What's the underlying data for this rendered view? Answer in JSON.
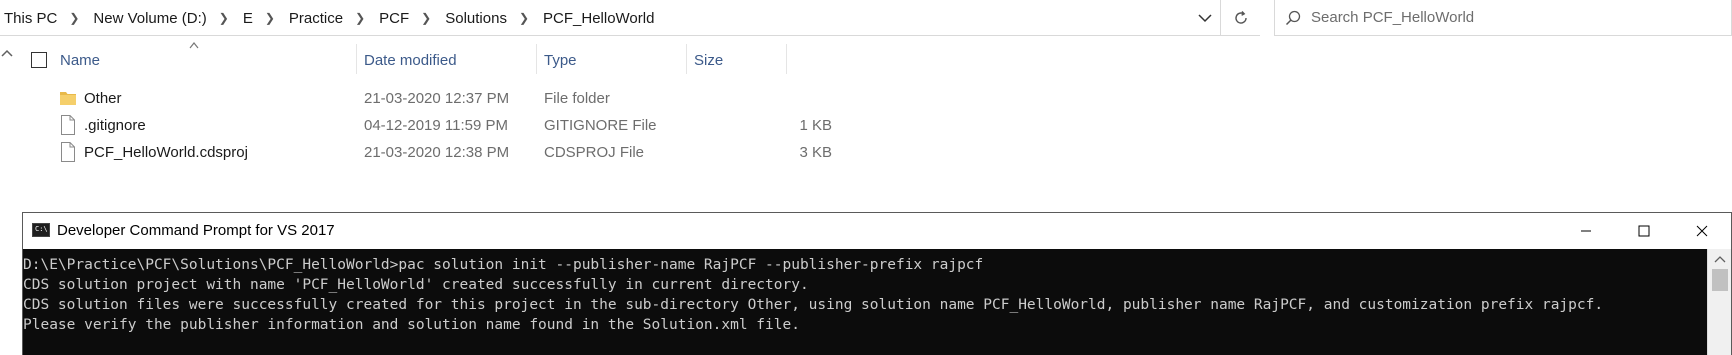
{
  "address_bar": {
    "breadcrumbs": [
      "This PC",
      "New Volume (D:)",
      "E",
      "Practice",
      "PCF",
      "Solutions",
      "PCF_HelloWorld"
    ],
    "search_placeholder": "Search PCF_HelloWorld"
  },
  "columns": {
    "name": "Name",
    "date_modified": "Date modified",
    "type": "Type",
    "size": "Size"
  },
  "files": [
    {
      "name": "Other",
      "date": "21-03-2020 12:37 PM",
      "type": "File folder",
      "size": "",
      "icon": "folder-icon"
    },
    {
      "name": ".gitignore",
      "date": "04-12-2019 11:59 PM",
      "type": "GITIGNORE File",
      "size": "1 KB",
      "icon": "file-icon"
    },
    {
      "name": "PCF_HelloWorld.cdsproj",
      "date": "21-03-2020 12:38 PM",
      "type": "CDSPROJ File",
      "size": "3 KB",
      "icon": "file-icon"
    }
  ],
  "console": {
    "title": "Developer Command Prompt for VS 2017",
    "icon_text": "C:\\",
    "lines": [
      "D:\\E\\Practice\\PCF\\Solutions\\PCF_HelloWorld>pac solution init --publisher-name RajPCF --publisher-prefix rajpcf",
      "CDS solution project with name 'PCF_HelloWorld' created successfully in current directory.",
      "CDS solution files were successfully created for this project in the sub-directory Other, using solution name PCF_HelloWorld, publisher name RajPCF, and customization prefix rajpcf.",
      "Please verify the publisher information and solution name found in the Solution.xml file."
    ]
  },
  "colors": {
    "folder": "#e8b94a",
    "header_text": "#3c5a8a",
    "console_bg": "#0c0c0c",
    "console_text": "#cccccc"
  }
}
